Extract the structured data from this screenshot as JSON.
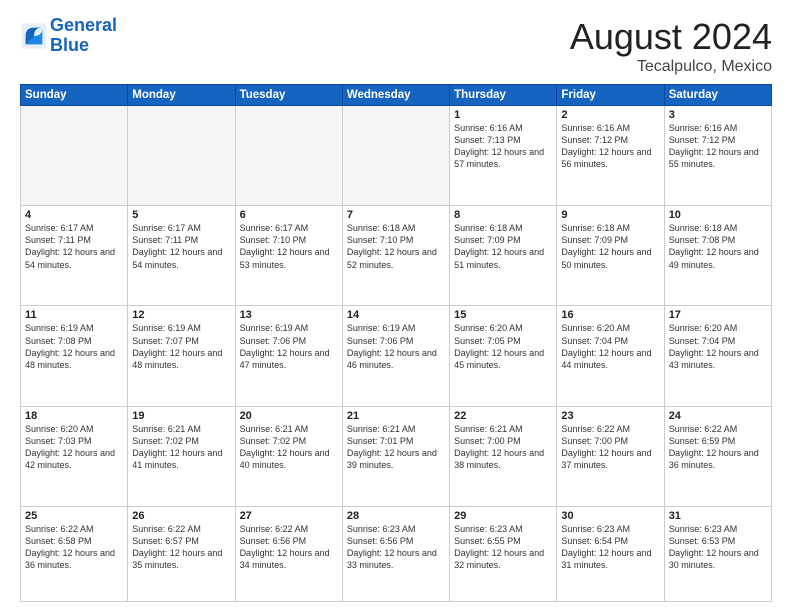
{
  "header": {
    "logo_line1": "General",
    "logo_line2": "Blue",
    "month_title": "August 2024",
    "location": "Tecalpulco, Mexico"
  },
  "days_of_week": [
    "Sunday",
    "Monday",
    "Tuesday",
    "Wednesday",
    "Thursday",
    "Friday",
    "Saturday"
  ],
  "weeks": [
    [
      {
        "day": "",
        "empty": true
      },
      {
        "day": "",
        "empty": true
      },
      {
        "day": "",
        "empty": true
      },
      {
        "day": "",
        "empty": true
      },
      {
        "day": "1",
        "sunrise": "6:16 AM",
        "sunset": "7:13 PM",
        "daylight": "12 hours and 57 minutes."
      },
      {
        "day": "2",
        "sunrise": "6:16 AM",
        "sunset": "7:12 PM",
        "daylight": "12 hours and 56 minutes."
      },
      {
        "day": "3",
        "sunrise": "6:16 AM",
        "sunset": "7:12 PM",
        "daylight": "12 hours and 55 minutes."
      }
    ],
    [
      {
        "day": "4",
        "sunrise": "6:17 AM",
        "sunset": "7:11 PM",
        "daylight": "12 hours and 54 minutes."
      },
      {
        "day": "5",
        "sunrise": "6:17 AM",
        "sunset": "7:11 PM",
        "daylight": "12 hours and 54 minutes."
      },
      {
        "day": "6",
        "sunrise": "6:17 AM",
        "sunset": "7:10 PM",
        "daylight": "12 hours and 53 minutes."
      },
      {
        "day": "7",
        "sunrise": "6:18 AM",
        "sunset": "7:10 PM",
        "daylight": "12 hours and 52 minutes."
      },
      {
        "day": "8",
        "sunrise": "6:18 AM",
        "sunset": "7:09 PM",
        "daylight": "12 hours and 51 minutes."
      },
      {
        "day": "9",
        "sunrise": "6:18 AM",
        "sunset": "7:09 PM",
        "daylight": "12 hours and 50 minutes."
      },
      {
        "day": "10",
        "sunrise": "6:18 AM",
        "sunset": "7:08 PM",
        "daylight": "12 hours and 49 minutes."
      }
    ],
    [
      {
        "day": "11",
        "sunrise": "6:19 AM",
        "sunset": "7:08 PM",
        "daylight": "12 hours and 48 minutes."
      },
      {
        "day": "12",
        "sunrise": "6:19 AM",
        "sunset": "7:07 PM",
        "daylight": "12 hours and 48 minutes."
      },
      {
        "day": "13",
        "sunrise": "6:19 AM",
        "sunset": "7:06 PM",
        "daylight": "12 hours and 47 minutes."
      },
      {
        "day": "14",
        "sunrise": "6:19 AM",
        "sunset": "7:06 PM",
        "daylight": "12 hours and 46 minutes."
      },
      {
        "day": "15",
        "sunrise": "6:20 AM",
        "sunset": "7:05 PM",
        "daylight": "12 hours and 45 minutes."
      },
      {
        "day": "16",
        "sunrise": "6:20 AM",
        "sunset": "7:04 PM",
        "daylight": "12 hours and 44 minutes."
      },
      {
        "day": "17",
        "sunrise": "6:20 AM",
        "sunset": "7:04 PM",
        "daylight": "12 hours and 43 minutes."
      }
    ],
    [
      {
        "day": "18",
        "sunrise": "6:20 AM",
        "sunset": "7:03 PM",
        "daylight": "12 hours and 42 minutes."
      },
      {
        "day": "19",
        "sunrise": "6:21 AM",
        "sunset": "7:02 PM",
        "daylight": "12 hours and 41 minutes."
      },
      {
        "day": "20",
        "sunrise": "6:21 AM",
        "sunset": "7:02 PM",
        "daylight": "12 hours and 40 minutes."
      },
      {
        "day": "21",
        "sunrise": "6:21 AM",
        "sunset": "7:01 PM",
        "daylight": "12 hours and 39 minutes."
      },
      {
        "day": "22",
        "sunrise": "6:21 AM",
        "sunset": "7:00 PM",
        "daylight": "12 hours and 38 minutes."
      },
      {
        "day": "23",
        "sunrise": "6:22 AM",
        "sunset": "7:00 PM",
        "daylight": "12 hours and 37 minutes."
      },
      {
        "day": "24",
        "sunrise": "6:22 AM",
        "sunset": "6:59 PM",
        "daylight": "12 hours and 36 minutes."
      }
    ],
    [
      {
        "day": "25",
        "sunrise": "6:22 AM",
        "sunset": "6:58 PM",
        "daylight": "12 hours and 36 minutes."
      },
      {
        "day": "26",
        "sunrise": "6:22 AM",
        "sunset": "6:57 PM",
        "daylight": "12 hours and 35 minutes."
      },
      {
        "day": "27",
        "sunrise": "6:22 AM",
        "sunset": "6:56 PM",
        "daylight": "12 hours and 34 minutes."
      },
      {
        "day": "28",
        "sunrise": "6:23 AM",
        "sunset": "6:56 PM",
        "daylight": "12 hours and 33 minutes."
      },
      {
        "day": "29",
        "sunrise": "6:23 AM",
        "sunset": "6:55 PM",
        "daylight": "12 hours and 32 minutes."
      },
      {
        "day": "30",
        "sunrise": "6:23 AM",
        "sunset": "6:54 PM",
        "daylight": "12 hours and 31 minutes."
      },
      {
        "day": "31",
        "sunrise": "6:23 AM",
        "sunset": "6:53 PM",
        "daylight": "12 hours and 30 minutes."
      }
    ]
  ]
}
